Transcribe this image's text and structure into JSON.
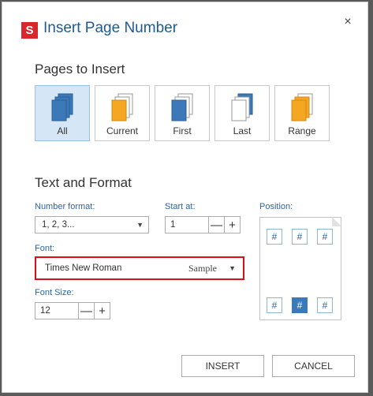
{
  "dialog": {
    "logo_letter": "S",
    "title": "Insert Page Number",
    "close_glyph": "×"
  },
  "pages_to_insert": {
    "heading": "Pages to Insert",
    "options": [
      {
        "label": "All",
        "selected": true
      },
      {
        "label": "Current",
        "selected": false
      },
      {
        "label": "First",
        "selected": false
      },
      {
        "label": "Last",
        "selected": false
      },
      {
        "label": "Range",
        "selected": false
      }
    ]
  },
  "text_and_format": {
    "heading": "Text and Format",
    "number_format": {
      "label": "Number format:",
      "value": "1, 2, 3..."
    },
    "start_at": {
      "label": "Start at:",
      "value": "1",
      "minus": "—",
      "plus": "+"
    },
    "font": {
      "label": "Font:",
      "value": "Times New Roman",
      "sample": "Sample"
    },
    "font_size": {
      "label": "Font Size:",
      "value": "12",
      "minus": "—",
      "plus": "+"
    },
    "position": {
      "label": "Position:",
      "glyph": "#",
      "selected": "bottom-center"
    }
  },
  "buttons": {
    "insert": "INSERT",
    "cancel": "CANCEL"
  },
  "colors": {
    "accent": "#1e5a96",
    "selected_tile": "#d5e6f6",
    "highlight": "#d80f14",
    "logo": "#d9262c"
  }
}
